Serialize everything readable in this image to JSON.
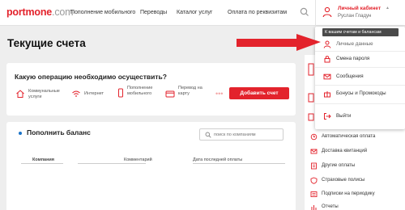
{
  "header": {
    "logo_brand": "portmone",
    "logo_tld": ".com",
    "nav": [
      "Пополнение мобильного",
      "Переводы",
      "Каталог услуг",
      "Оплата по реквизитам"
    ],
    "cabinet_title": "Личный кабинет",
    "user_name": "Руслан Гладун"
  },
  "page": {
    "title": "Текущие счета"
  },
  "operations": {
    "question": "Какую операцию необходимо осуществить?",
    "items": [
      {
        "label": "Коммунальные услуги",
        "icon": "house-icon"
      },
      {
        "label": "Интернет",
        "icon": "wifi-icon"
      },
      {
        "label": "Пополнение мобильного",
        "icon": "phone-icon"
      },
      {
        "label": "Перевод на карту",
        "icon": "card-icon"
      }
    ],
    "more": "•••",
    "add_button": "Добавить счет"
  },
  "balance": {
    "title": "Пополнить баланс",
    "search_placeholder": "поиск по компаниям",
    "columns": [
      "Компания",
      "Комментарий",
      "Дата последней оплаты"
    ]
  },
  "tooltip": "К вашим счетам и балансам",
  "dropdown": [
    {
      "label": "Личные данные",
      "icon": "user-icon"
    },
    {
      "label": "Смена пароля",
      "icon": "lock-icon"
    },
    {
      "label": "Сообщения",
      "icon": "mail-icon"
    },
    {
      "label": "Бонусы и Промокоды",
      "icon": "gift-icon"
    },
    {
      "label": "Выйти",
      "icon": "logout-icon"
    }
  ],
  "sidebar": [
    {
      "label": "Автоматическая оплата",
      "icon": "auto-pay-icon"
    },
    {
      "label": "Доставка квитанций",
      "icon": "receipt-icon"
    },
    {
      "label": "Другие оплаты",
      "icon": "list-icon"
    },
    {
      "label": "Страховые полисы",
      "icon": "shield-icon"
    },
    {
      "label": "Подписки на периодику",
      "icon": "newspaper-icon"
    },
    {
      "label": "Отчеты",
      "icon": "report-icon"
    }
  ],
  "colors": {
    "accent": "#e3232c",
    "arrow": "#e3232c",
    "bullet": "#1a73c8"
  }
}
